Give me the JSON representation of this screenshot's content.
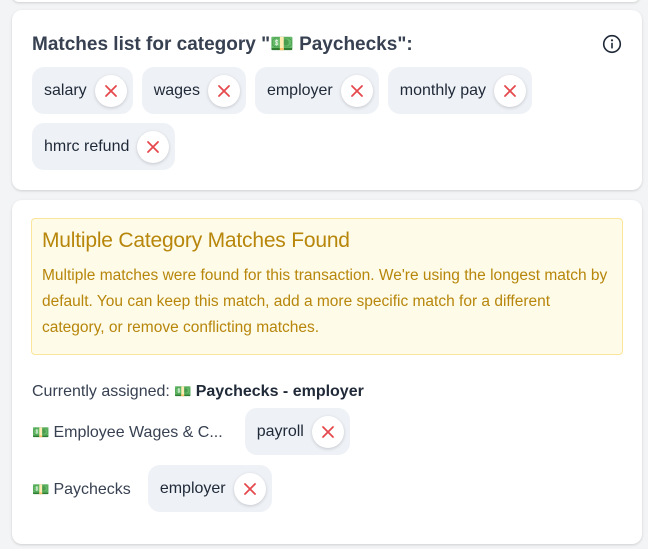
{
  "matches_card": {
    "title": "Matches list for category \"💵 Paychecks\":",
    "keywords": [
      {
        "label": "salary"
      },
      {
        "label": "wages"
      },
      {
        "label": "employer"
      },
      {
        "label": "monthly pay"
      },
      {
        "label": "hmrc refund"
      }
    ]
  },
  "multi_card": {
    "alert_title": "Multiple Category Matches Found",
    "alert_body": "Multiple matches were found for this transaction. We're using the longest match by default. You can keep this match, add a more specific match for a different category, or remove conflicting matches.",
    "assigned_prefix": "Currently assigned:",
    "assigned_emoji": "💵",
    "assigned_value": "Paychecks - employer",
    "categories": [
      {
        "emoji": "💵",
        "name": "Employee Wages & C...",
        "match": "payroll"
      },
      {
        "emoji": "💵",
        "name": "Paychecks",
        "match": "employer"
      }
    ]
  },
  "colors": {
    "remove_x": "#e5484d",
    "alert_text": "#b7860b",
    "alert_bg": "#fefbe8",
    "chip_bg": "#eef1f6"
  }
}
